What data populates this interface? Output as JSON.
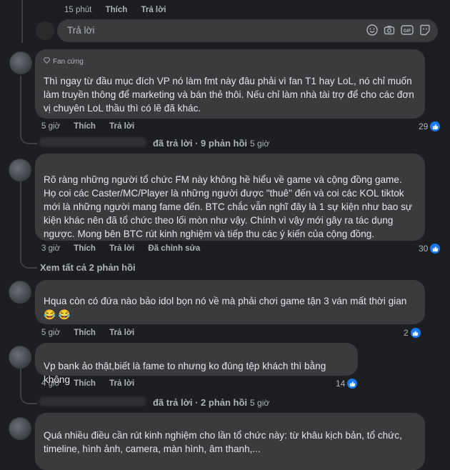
{
  "top_meta": {
    "time": "15 phút",
    "like": "Thích",
    "reply": "Trả lời"
  },
  "reply_box": {
    "placeholder": "Trả lời",
    "icons": [
      "emoji-icon",
      "camera-icon",
      "gif-icon",
      "sticker-icon"
    ]
  },
  "comments": [
    {
      "badge": "Fan cứng",
      "text": "Thì ngay từ đầu mục đích VP nó làm fmt này đâu phải vì fan T1 hay LoL, nó chỉ muốn làm truyền thông để marketing và bán thẻ thôi. Nếu chỉ làm nhà tài trợ để cho các đơn vị chuyên LoL                        thầu thì có lẽ đã khác.",
      "time": "5 giờ",
      "like": "Thích",
      "reply": "Trả lời",
      "likes": "29",
      "replies_summary": "đã trả lời · 9 phản hồi",
      "replies_time": "5 giờ"
    },
    {
      "text": "Rõ ràng những người tổ chức FM này không hề hiểu về game và cộng đồng game. Họ coi các Caster/MC/Player là những người được \"thuê\" đến và coi các KOL tiktok mới là những người mang fame đến. BTC chắc vẫn nghĩ đây là 1 sự kiện như bao sự kiện khác nên đã tổ chức theo lối mòn như vậy. Chính vì vậy mới gây ra tác dụng ngược. Mong bên BTC rút kinh nghiệm và tiếp thu các ý kiến của cộng đồng.",
      "time": "3 giờ",
      "like": "Thích",
      "reply": "Trả lời",
      "edited": "Đã chỉnh sửa",
      "likes": "30",
      "see_all": "Xem tất cả 2 phản hồi"
    },
    {
      "text": "Hqua còn có đứa nào bảo idol bọn nó về mà phải chơi game tận 3 ván mất thời gian 😂 😂",
      "time": "5 giờ",
      "like": "Thích",
      "reply": "Trả lời",
      "likes": "2"
    },
    {
      "text": "Vp bank ảo thật,biết là fame to nhưng ko đúng tệp khách thì bằng không",
      "time": "4 giờ",
      "like": "Thích",
      "reply": "Trả lời",
      "likes": "14",
      "replies_summary": "đã trả lời · 2 phản hồi",
      "replies_time": "5 giờ"
    },
    {
      "text": "Quá nhiều điều cần rút kinh nghiệm cho lần tổ chức này: từ khâu kịch bản, tổ chức, timeline, hình ảnh, camera, màn hình, âm thanh,..."
    }
  ],
  "colors": {
    "background": "#1c1e21",
    "bubble": "#3a3b3c",
    "muted": "#b0b3b8",
    "like_blue": "#1877f2"
  }
}
